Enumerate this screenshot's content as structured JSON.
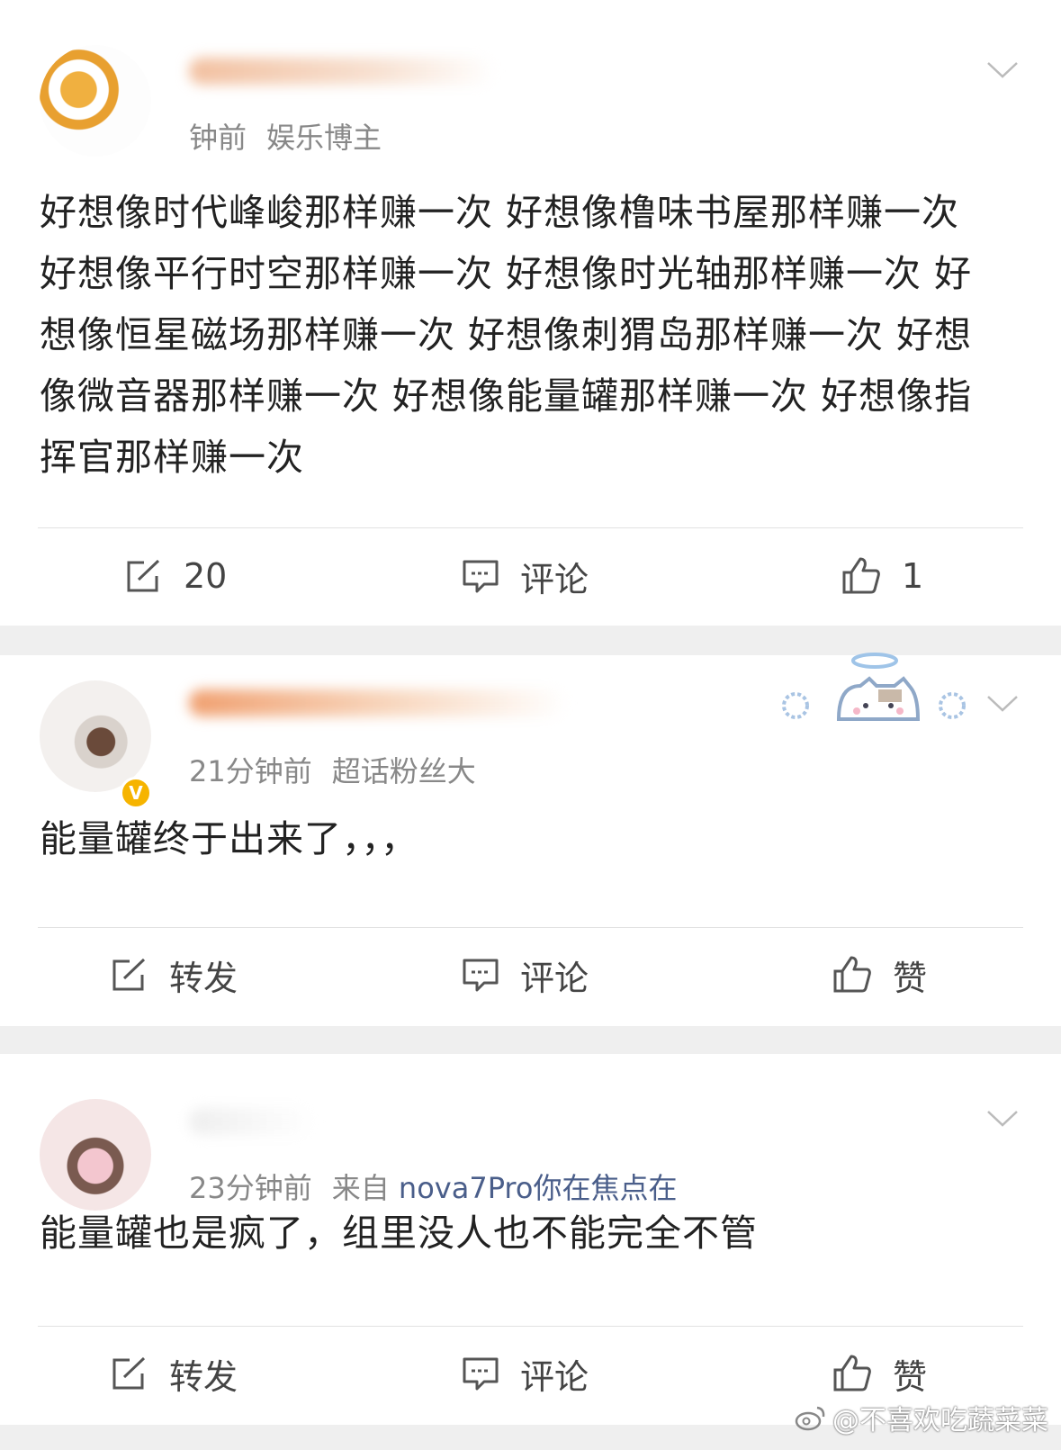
{
  "posts": [
    {
      "meta_time": "钟前",
      "meta_tag": "娱乐博主",
      "meta_source": "",
      "body": "好想像时代峰峻那样赚一次 好想像橹味书屋那样赚一次 好想像平行时空那样赚一次 好想像时光轴那样赚一次 好想像恒星磁场那样赚一次 好想像刺猬岛那样赚一次 好想像微音器那样赚一次 好想像能量罐那样赚一次 好想像指挥官那样赚一次",
      "actions": {
        "repost": "20",
        "comment": "评论",
        "like": "1"
      }
    },
    {
      "meta_time": "21分钟前",
      "meta_tag": "超话粉丝大",
      "meta_source": "",
      "body": "能量罐终于出来了，，，",
      "actions": {
        "repost": "转发",
        "comment": "评论",
        "like": "赞"
      }
    },
    {
      "meta_time": "23分钟前",
      "meta_tag": "来自",
      "meta_source": "nova7Pro你在焦点在",
      "body": "能量罐也是疯了，组里没人也不能完全不管",
      "actions": {
        "repost": "转发",
        "comment": "评论",
        "like": "赞"
      }
    }
  ],
  "badge": {
    "verified": "V"
  },
  "watermark": "@不喜欢吃蔬菜菜",
  "colors": {
    "accent": "#ff8200",
    "source_link": "#4a5e8a",
    "page_bg": "#efefef"
  },
  "icons": [
    "repost-icon",
    "comment-icon",
    "like-icon",
    "chevron-down-icon",
    "weibo-logo-icon",
    "verified-badge-icon"
  ]
}
